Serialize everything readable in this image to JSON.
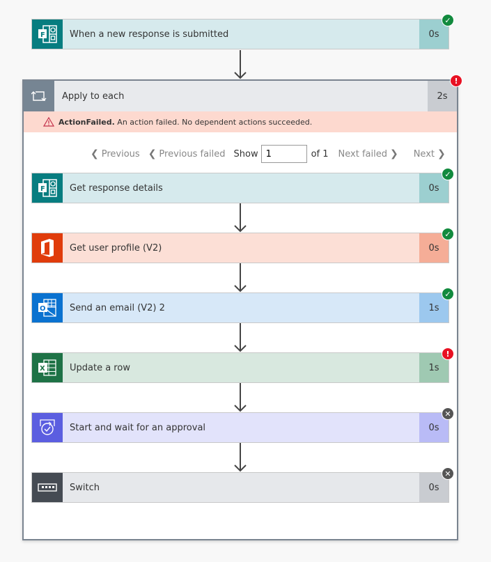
{
  "trigger": {
    "title": "When a new response is submitted",
    "duration": "0s",
    "status": "succeeded",
    "icon": "forms-icon",
    "colors": {
      "icon_bg": "#077d80",
      "body_bg": "#d6eaed",
      "dur_bg": "#9ccfd0"
    }
  },
  "loop": {
    "title": "Apply to each",
    "duration": "2s",
    "status": "failed",
    "icon": "loop-icon",
    "error": {
      "code": "ActionFailed.",
      "message": " An action failed. No dependent actions succeeded."
    },
    "pager": {
      "previous": "Previous",
      "previous_failed": "Previous failed",
      "show": "Show",
      "current": "1",
      "of": "of 1",
      "next_failed": "Next failed",
      "next": "Next"
    },
    "actions": [
      {
        "title": "Get response details",
        "duration": "0s",
        "status": "succeeded",
        "icon": "forms-icon",
        "colors": {
          "icon_bg": "#077d80",
          "body_bg": "#d6eaed",
          "dur_bg": "#9ccfd0"
        }
      },
      {
        "title": "Get user profile (V2)",
        "duration": "0s",
        "status": "succeeded",
        "icon": "office-icon",
        "colors": {
          "icon_bg": "#e03c0b",
          "body_bg": "#fcdfd6",
          "dur_bg": "#f5ad97"
        }
      },
      {
        "title": "Send an email (V2) 2",
        "duration": "1s",
        "status": "succeeded",
        "icon": "outlook-icon",
        "colors": {
          "icon_bg": "#0a72d0",
          "body_bg": "#d7e8f8",
          "dur_bg": "#9cc8ee"
        }
      },
      {
        "title": "Update a row",
        "duration": "1s",
        "status": "failed",
        "icon": "excel-icon",
        "colors": {
          "icon_bg": "#1e7246",
          "body_bg": "#d8e8df",
          "dur_bg": "#9fc9b2"
        }
      },
      {
        "title": "Start and wait for an approval",
        "duration": "0s",
        "status": "skipped",
        "icon": "approval-icon",
        "colors": {
          "icon_bg": "#5b5ee0",
          "body_bg": "#e2e3fb",
          "dur_bg": "#b9bbf6"
        }
      },
      {
        "title": "Switch",
        "duration": "0s",
        "status": "skipped",
        "icon": "switch-icon",
        "colors": {
          "icon_bg": "#454b53",
          "body_bg": "#e6e8eb",
          "dur_bg": "#c9ccd1"
        }
      }
    ]
  },
  "status_colors": {
    "succeeded": "#128a3e",
    "failed": "#e81123",
    "skipped": "#555555"
  }
}
